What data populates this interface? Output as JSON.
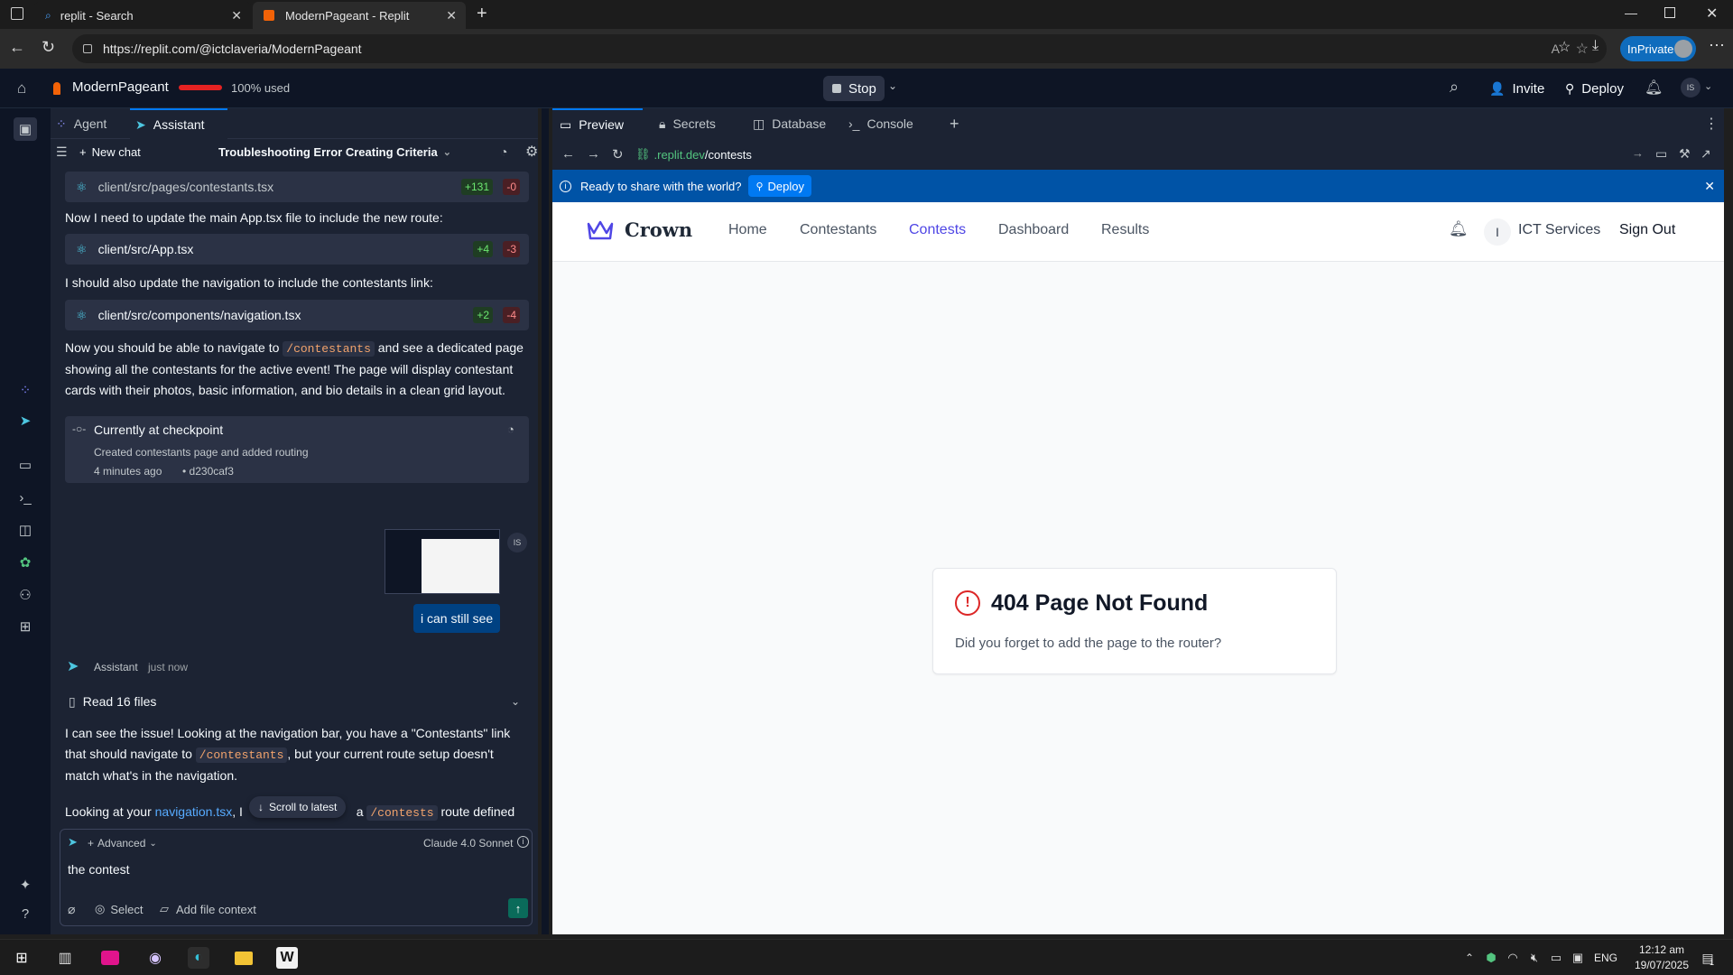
{
  "browser": {
    "tabs": [
      {
        "title": "replit - Search"
      },
      {
        "title": "ModernPageant - Replit"
      }
    ],
    "url": "https://replit.com/@ictclaveria/ModernPageant",
    "inprivate_label": "InPrivate"
  },
  "replit_header": {
    "project_name": "ModernPageant",
    "usage": "100% used",
    "stop_label": "Stop",
    "invite_label": "Invite",
    "deploy_label": "Deploy",
    "user_initials": "IS"
  },
  "chat": {
    "tabs": [
      {
        "label": "Agent"
      },
      {
        "label": "Assistant"
      }
    ],
    "new_chat_label": "New chat",
    "chat_title": "Troubleshooting Error Creating Criteria",
    "file_cards": [
      {
        "path": "client/src/pages/contestants.tsx",
        "added": "+131",
        "removed": "-0"
      },
      {
        "path": "client/src/App.tsx",
        "added": "+4",
        "removed": "-3"
      },
      {
        "path": "client/src/components/navigation.tsx",
        "added": "+2",
        "removed": "-4"
      }
    ],
    "msg_update_app": "Now I need to update the main App.tsx file to include the new route:",
    "msg_update_nav": "I should also update the navigation to include the contestants link:",
    "msg_navigate_pre": "Now you should be able to navigate to",
    "msg_navigate_code": "/contestants",
    "msg_navigate_post": "and see a dedicated page showing all the contestants for the active event! The page will display contestant cards with their photos, basic information, and bio details in a clean grid layout.",
    "checkpoint": {
      "title": "Currently at checkpoint",
      "description": "Created contestants page and added routing",
      "time": "4 minutes ago",
      "hash": "d230caf3"
    },
    "user_initials": "IS",
    "user_message": "i can still see",
    "assistant_label": "Assistant",
    "assistant_time": "just now",
    "read_files": "Read 16 files",
    "reply_p1_a": "I can see the issue! Looking at the navigation bar, you have a \"Contestants\" link that should navigate to",
    "reply_p1_code": "/contestants",
    "reply_p1_b": ", but your current route setup doesn't match what's in the navigation.",
    "reply_p2_a": "Looking at your",
    "reply_p2_link": "navigation.tsx",
    "reply_p2_b": ", I",
    "reply_p2_c": "a",
    "reply_p2_code": "/contests",
    "reply_p2_d": "route defined but",
    "scroll_latest": "Scroll to latest",
    "composer": {
      "advanced_label": "Advanced",
      "model": "Claude 4.0 Sonnet",
      "input_value": "the contest",
      "select_label": "Select",
      "add_file_label": "Add file context"
    }
  },
  "preview": {
    "tabs": [
      {
        "label": "Preview"
      },
      {
        "label": "Secrets"
      },
      {
        "label": "Database"
      },
      {
        "label": "Console"
      }
    ],
    "url_domain": ".replit.dev",
    "url_path": "/contests",
    "banner_text": "Ready to share with the world?",
    "banner_deploy": "Deploy",
    "site": {
      "brand": "Crown",
      "nav": [
        "Home",
        "Contestants",
        "Contests",
        "Dashboard",
        "Results"
      ],
      "active_nav": "Contests",
      "user_initial": "I",
      "user_name": "ICT Services",
      "sign_out": "Sign Out",
      "error_title": "404 Page Not Found",
      "error_message": "Did you forget to add the page to the router?"
    }
  },
  "taskbar": {
    "language": "ENG",
    "time": "12:12 am",
    "date": "19/07/2025",
    "notifications": "1"
  },
  "colors": {
    "accent_blue": "#0079f2",
    "replit_orange": "#f26207",
    "danger_red": "#dc2626",
    "site_active": "#4f46e5"
  }
}
